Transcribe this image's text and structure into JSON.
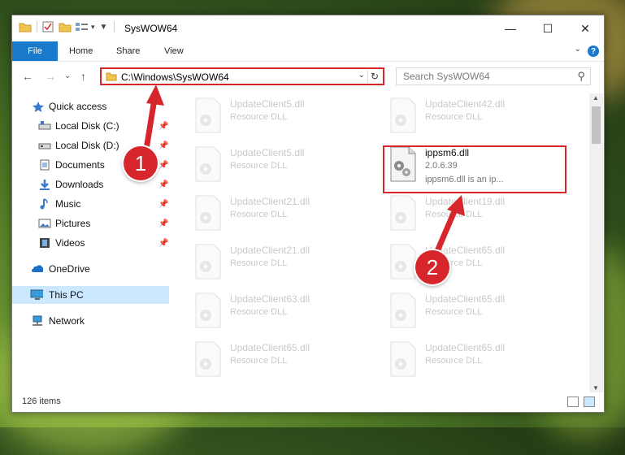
{
  "window": {
    "title": "SysWOW64",
    "controls": {
      "minimize": "—",
      "maximize": "☐",
      "close": "✕"
    }
  },
  "ribbon": {
    "file": "File",
    "tabs": [
      "Home",
      "Share",
      "View"
    ],
    "help": "?"
  },
  "address": {
    "path": "C:\\Windows\\SysWOW64",
    "search_placeholder": "Search SysWOW64"
  },
  "nav": {
    "items": [
      {
        "label": "Quick access",
        "icon": "star-icon",
        "pinned": false
      },
      {
        "label": "Local Disk (C:)",
        "icon": "drive-icon",
        "pinned": true
      },
      {
        "label": "Local Disk (D:)",
        "icon": "drive-icon",
        "pinned": true
      },
      {
        "label": "Documents",
        "icon": "documents-icon",
        "pinned": true
      },
      {
        "label": "Downloads",
        "icon": "downloads-icon",
        "pinned": true
      },
      {
        "label": "Music",
        "icon": "music-icon",
        "pinned": true
      },
      {
        "label": "Pictures",
        "icon": "pictures-icon",
        "pinned": true
      },
      {
        "label": "Videos",
        "icon": "videos-icon",
        "pinned": true
      },
      {
        "label": "OneDrive",
        "icon": "onedrive-icon",
        "pinned": false
      },
      {
        "label": "This PC",
        "icon": "this-pc-icon",
        "pinned": false,
        "selected": true
      },
      {
        "label": "Network",
        "icon": "network-icon",
        "pinned": false
      }
    ]
  },
  "files": {
    "left": [
      {
        "name": "UpdateClient5.dll",
        "desc": "Resource DLL"
      },
      {
        "name": "UpdateClient5.dll",
        "desc": "Resource DLL"
      },
      {
        "name": "UpdateClient21.dll",
        "desc": "Resource DLL"
      },
      {
        "name": "UpdateClient21.dll",
        "desc": "Resource DLL"
      },
      {
        "name": "UpdateClient63.dll",
        "desc": "Resource DLL"
      },
      {
        "name": "UpdateClient65.dll",
        "desc": "Resource DLL"
      }
    ],
    "right": [
      {
        "name": "UpdateClient42.dll",
        "desc": "Resource DLL"
      },
      {
        "name": "ippsm6.dll",
        "desc": "2.0.6.39",
        "extra": "ippsm6.dll is an ip...",
        "highlighted": true
      },
      {
        "name": "UpdateClient19.dll",
        "desc": "Resource DLL"
      },
      {
        "name": "UpdateClient65.dll",
        "desc": "Resource DLL"
      },
      {
        "name": "UpdateClient65.dll",
        "desc": "Resource DLL"
      },
      {
        "name": "UpdateClient65.dll",
        "desc": "Resource DLL"
      }
    ]
  },
  "status": {
    "items": "126 items"
  },
  "annotations": {
    "step1": "1",
    "step2": "2"
  },
  "colors": {
    "accent": "#1979ca",
    "highlight": "#d6262b",
    "selected": "#cce8ff"
  }
}
